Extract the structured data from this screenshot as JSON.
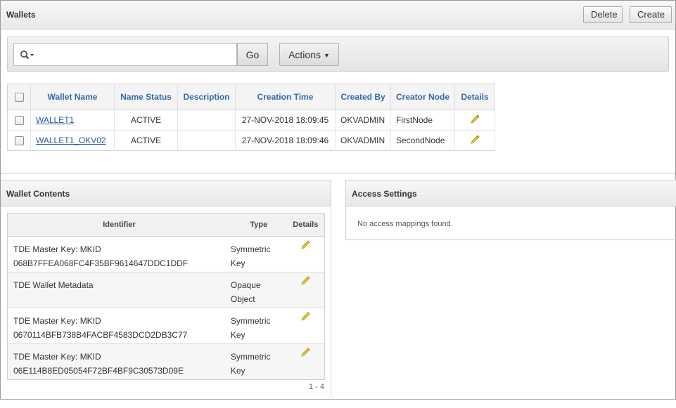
{
  "wallets": {
    "title": "Wallets",
    "delete_label": "Delete",
    "create_label": "Create"
  },
  "toolbar": {
    "search_value": "",
    "go_label": "Go",
    "actions_label": "Actions"
  },
  "wallets_table": {
    "columns": [
      "Wallet Name",
      "Name Status",
      "Description",
      "Creation Time",
      "Created By",
      "Creator Node",
      "Details"
    ],
    "rows": [
      {
        "name": "WALLET1",
        "status": "ACTIVE",
        "description": "",
        "created": "27-NOV-2018 18:09:45",
        "created_by": "OKVADMIN",
        "node": "FirstNode"
      },
      {
        "name": "WALLET1_OKV02",
        "status": "ACTIVE",
        "description": "",
        "created": "27-NOV-2018 18:09:46",
        "created_by": "OKVADMIN",
        "node": "SecondNode"
      }
    ]
  },
  "contents": {
    "title": "Wallet Contents",
    "columns": [
      "Identifier",
      "Type",
      "Details"
    ],
    "rows": [
      {
        "id_line1": "TDE Master Key: MKID",
        "id_line2": "068B7FFEA068FC4F35BF9614647DDC1DDF",
        "type_line1": "Symmetric",
        "type_line2": "Key"
      },
      {
        "id_line1": "TDE Wallet Metadata",
        "id_line2": "",
        "type_line1": "Opaque",
        "type_line2": "Object"
      },
      {
        "id_line1": "TDE Master Key: MKID",
        "id_line2": "0670114BFB738B4FACBF4583DCD2DB3C77",
        "type_line1": "Symmetric",
        "type_line2": "Key"
      },
      {
        "id_line1": "TDE Master Key: MKID",
        "id_line2": "06E114B8ED05054F72BF4BF9C30573D09E",
        "type_line1": "Symmetric",
        "type_line2": "Key"
      }
    ],
    "pagination": "1 - 4"
  },
  "access": {
    "title": "Access Settings",
    "empty_message": "No access mappings found."
  },
  "icons": {
    "search": "search-icon",
    "edit": "pencil-icon"
  },
  "colors": {
    "link": "#2b56a5",
    "header_text": "#3a67a8",
    "active_status": "#1f8a1f",
    "pencil": "#e8c21a"
  }
}
